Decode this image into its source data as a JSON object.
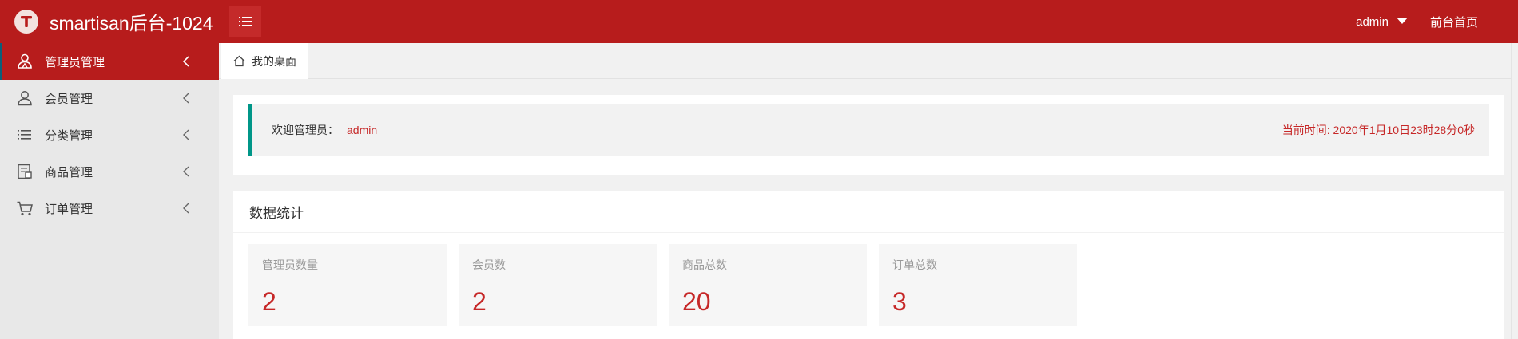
{
  "header": {
    "logo_letter": "T",
    "title": "smartisan后台-1024",
    "user": "admin",
    "front_link": "前台首页",
    "brand_color": "#b71c1c"
  },
  "sidebar": {
    "items": [
      {
        "label": "管理员管理",
        "icon": "admin-users-icon",
        "active": true
      },
      {
        "label": "会员管理",
        "icon": "user-icon",
        "active": false
      },
      {
        "label": "分类管理",
        "icon": "list-icon",
        "active": false
      },
      {
        "label": "商品管理",
        "icon": "product-icon",
        "active": false
      },
      {
        "label": "订单管理",
        "icon": "cart-icon",
        "active": false
      }
    ]
  },
  "tabs": [
    {
      "label": "我的桌面",
      "icon": "home-icon",
      "active": true
    }
  ],
  "welcome": {
    "label": "欢迎管理员：",
    "admin_name": "admin",
    "time_text": "当前时间: 2020年1月10日23时28分0秒",
    "accent_color": "#009688"
  },
  "stats": {
    "title": "数据统计",
    "items": [
      {
        "label": "管理员数量",
        "value": "2"
      },
      {
        "label": "会员数",
        "value": "2"
      },
      {
        "label": "商品总数",
        "value": "20"
      },
      {
        "label": "订单总数",
        "value": "3"
      }
    ]
  }
}
